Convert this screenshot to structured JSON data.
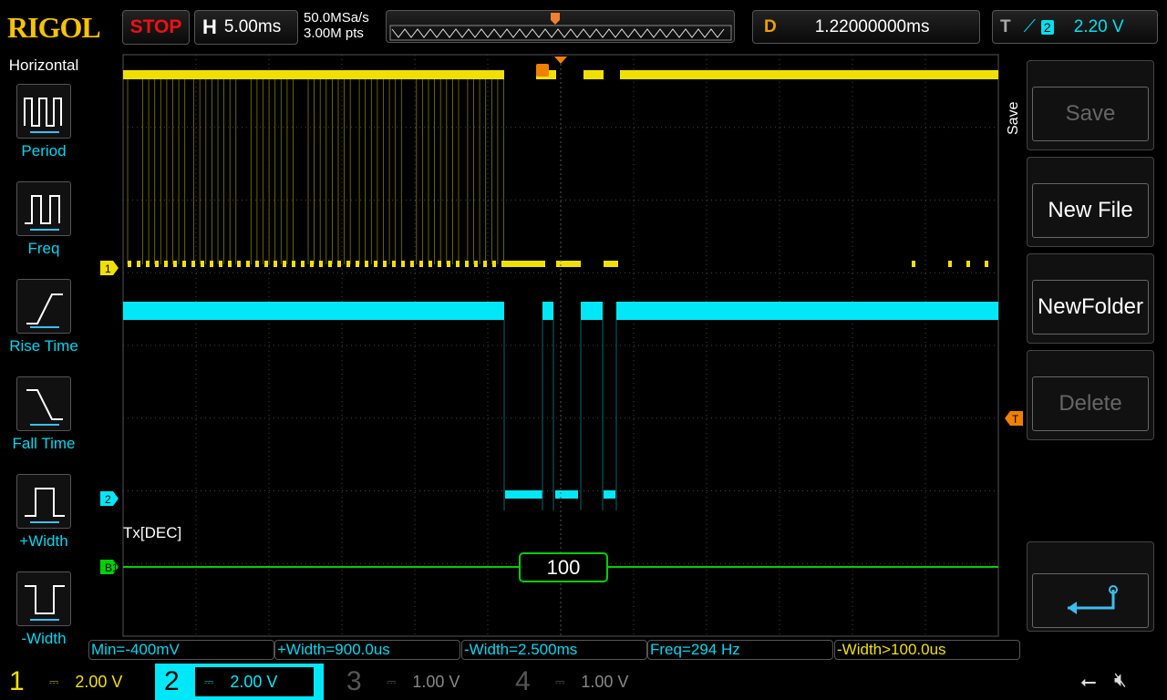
{
  "header": {
    "logo": "RIGOL",
    "run_state": "STOP",
    "timebase_key": "H",
    "timebase": "5.00ms",
    "sample_rate": "50.0MSa/s",
    "memory_depth": "3.00M pts",
    "delay_key": "D",
    "delay": "1.22000000ms",
    "trigger_key": "T",
    "trigger_source": "2",
    "trigger_level": "2.20 V",
    "trigger_marker": "T"
  },
  "left_menu": {
    "title": "Horizontal",
    "items": [
      {
        "label": "Period"
      },
      {
        "label": "Freq"
      },
      {
        "label": "Rise Time"
      },
      {
        "label": "Fall Time"
      },
      {
        "label": "+Width"
      },
      {
        "label": "-Width"
      }
    ]
  },
  "right_menu": {
    "title": "Save",
    "items": [
      {
        "label": "Save",
        "disabled": true
      },
      {
        "label": "New File"
      },
      {
        "label": "NewFolder"
      },
      {
        "label": "Delete",
        "disabled": true
      }
    ],
    "return": "return-icon"
  },
  "markers": {
    "ch1": "1",
    "ch2": "2",
    "bus": "B1",
    "trigger": "T"
  },
  "decode": {
    "label": "Tx[DEC]",
    "value": "100"
  },
  "measurements": [
    "Min=-400mV",
    "+Width=900.0us",
    "-Width=2.500ms",
    "Freq=294 Hz",
    "-Width>100.0us"
  ],
  "channels": [
    {
      "num": "1",
      "scale": "2.00 V",
      "color": "#f0e000"
    },
    {
      "num": "2",
      "scale": "2.00 V",
      "color": "#00e8f8"
    },
    {
      "num": "3",
      "scale": "1.00 V",
      "color": "#c000c0"
    },
    {
      "num": "4",
      "scale": "1.00 V",
      "color": "#2060c0"
    }
  ],
  "colors": {
    "ch1": "#f0e000",
    "ch2": "#00e8f8",
    "bus": "#00d000",
    "trigger": "#f08000"
  }
}
